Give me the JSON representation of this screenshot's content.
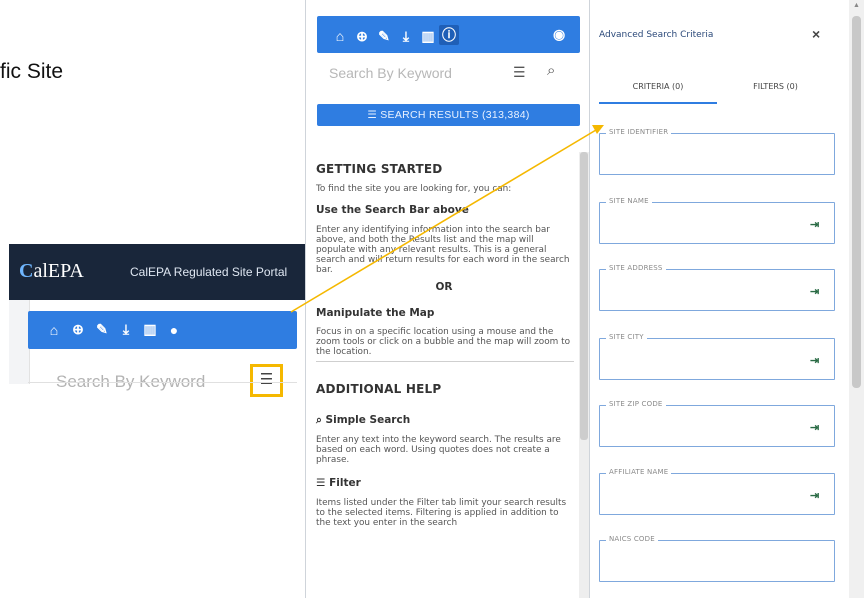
{
  "slide": {
    "text": "fic Site"
  },
  "inset": {
    "logo_c": "C",
    "logo_rest": "alEPA",
    "portal_title": "CalEPA Regulated Site Portal",
    "search_placeholder": "Search By Keyword"
  },
  "toolbar": {
    "icons": [
      "home-icon",
      "crosshair-icon",
      "ruler-icon",
      "download-icon",
      "map-icon",
      "info-icon"
    ],
    "eye": "eye-icon"
  },
  "search": {
    "placeholder": "Search By Keyword"
  },
  "results_button": {
    "label": "☰ SEARCH RESULTS (313,384)"
  },
  "help": {
    "getting_started": "GETTING STARTED",
    "intro": "To find the site you are looking for, you can:",
    "use_search": "Use the Search Bar above",
    "use_search_text": "Enter any identifying information into the search bar above, and both the Results list and the map will populate with any relevant results. This is a general search and will return results for each word in the search bar.",
    "or": "OR",
    "manipulate_map": "Manipulate the Map",
    "manipulate_text": "Focus in on a specific location using a mouse and the zoom tools or click on a bubble and the map will zoom to the location.",
    "additional_help": "ADDITIONAL HELP",
    "simple_search": "Simple Search",
    "simple_search_text": "Enter any text into the keyword search. The results are based on each word. Using quotes does not create a phrase.",
    "filter": "Filter",
    "filter_text": "Items listed under the Filter tab limit your search results to the selected items. Filtering is applied in addition to the text you enter in the search"
  },
  "advanced": {
    "title": "Advanced Search Criteria",
    "close": "×",
    "tab_criteria": "CRITERIA (0)",
    "tab_filters": "FILTERS (0)",
    "fields": [
      {
        "label": "SITE IDENTIFIER"
      },
      {
        "label": "SITE NAME"
      },
      {
        "label": "SITE ADDRESS"
      },
      {
        "label": "SITE CITY"
      },
      {
        "label": "SITE ZIP CODE"
      },
      {
        "label": "AFFILIATE NAME"
      },
      {
        "label": "NAICS CODE"
      }
    ]
  },
  "colors": {
    "accent": "#2f7de1",
    "header": "#19263a",
    "highlight": "#f5b800"
  }
}
